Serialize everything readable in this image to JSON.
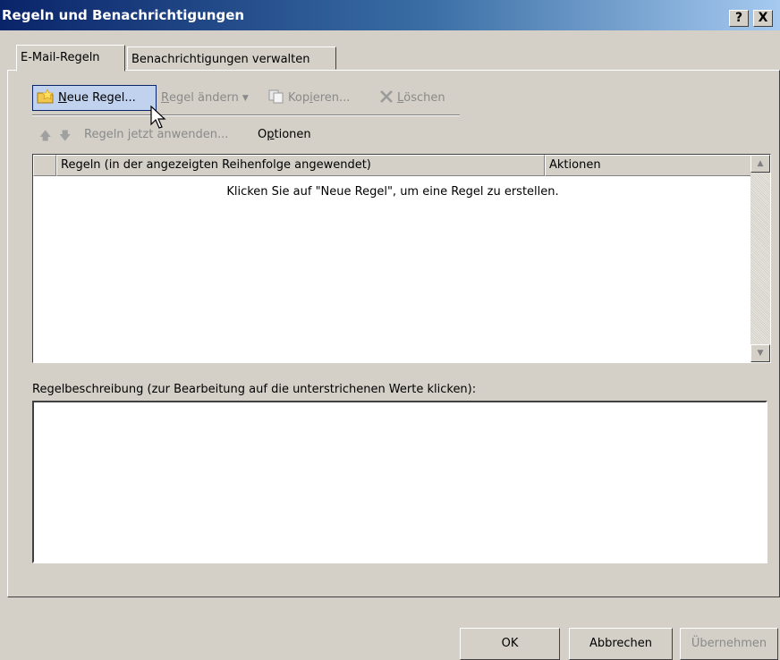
{
  "window": {
    "title": "Regeln und Benachrichtigungen",
    "help_label": "?",
    "close_label": "X"
  },
  "tabs": [
    {
      "label": "E-Mail-Regeln",
      "active": true
    },
    {
      "label": "Benachrichtigungen verwalten",
      "active": false
    }
  ],
  "toolbar": {
    "new_rule": {
      "accel": "N",
      "rest": "eue Regel...",
      "icon": "new-rule-icon"
    },
    "change_rule": {
      "accel": "R",
      "rest": "egel ändern",
      "icon": "chevron-down-icon",
      "enabled": false
    },
    "copy": {
      "pre": "Kop",
      "accel": "i",
      "post": "eren...",
      "icon": "copy-icon",
      "enabled": false
    },
    "delete": {
      "accel": "L",
      "rest": "öschen",
      "icon": "delete-x-icon",
      "enabled": false
    }
  },
  "toolbar2": {
    "move_up_icon": "arrow-up-icon",
    "move_down_icon": "arrow-down-icon",
    "apply_rules": {
      "pre": "Regeln ",
      "accel": "j",
      "post": "etzt anwenden...",
      "enabled": false
    },
    "options": {
      "pre": "O",
      "accel": "p",
      "post": "tionen",
      "enabled": true
    }
  },
  "rules_list": {
    "columns": [
      "",
      "Regeln (in der angezeigten Reihenfolge angewendet)",
      "Aktionen"
    ],
    "empty_message": "Klicken Sie auf \"Neue Regel\", um eine Regel zu erstellen."
  },
  "description": {
    "label": "Regelbeschreibung (zur Bearbeitung auf die unterstrichenen Werte klicken):",
    "text": ""
  },
  "buttons": {
    "ok": "OK",
    "cancel": "Abbrechen",
    "apply": "Übernehmen",
    "apply_enabled": false
  },
  "colors": {
    "dialog_bg": "#d4d0c8",
    "titlebar_start": "#0a246a",
    "titlebar_end": "#a6caf0",
    "disabled_text": "#8a8a8a",
    "hover_bg": "#c1d2ee",
    "hover_border": "#0a246a"
  }
}
